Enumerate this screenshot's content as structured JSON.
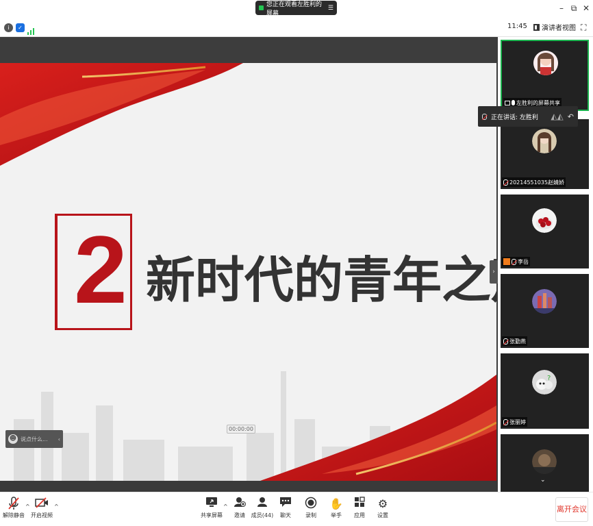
{
  "window": {
    "share_banner": "您正在观看左胜利的屏幕",
    "share_menu_icon": "menu-icon",
    "minimize": "–",
    "restore": "⧉",
    "close": "✕"
  },
  "subbar": {
    "time": "11:45",
    "view_label": "演讲者视图",
    "fullscreen_icon": "⛶"
  },
  "slide": {
    "number": "2",
    "title": "新时代的青年之声",
    "timer": "00:00:00",
    "accent": "#b8141a"
  },
  "chat_pill": {
    "placeholder": "说点什么...",
    "arrow": "‹"
  },
  "speaker": {
    "label": "正在讲话: 左胜利"
  },
  "participants": [
    {
      "name": "左胜利的屏幕共享"
    },
    {
      "name": "20214551035赵婧娇"
    },
    {
      "name": "李岳"
    },
    {
      "name": "张勤燕"
    },
    {
      "name": "张丽婷"
    },
    {
      "name": ""
    }
  ],
  "toolbar": {
    "unmute": "解除静音",
    "video": "开启视频",
    "share": "共享屏幕",
    "invite": "邀请",
    "members": "成员(44)",
    "chat": "聊天",
    "record": "录制",
    "raise_hand": "举手",
    "apps": "应用",
    "settings": "设置",
    "leave": "离开会议"
  }
}
